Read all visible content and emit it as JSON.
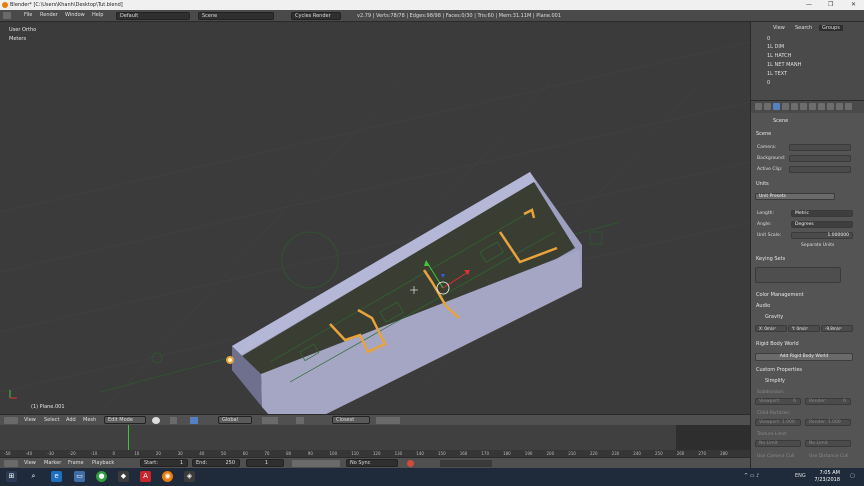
{
  "window": {
    "title": "Blender* [C:\\Users\\Khanh\\Desktop\\Tut.blend]",
    "controls": [
      "—",
      "❐",
      "✕"
    ]
  },
  "topbar": {
    "menus": [
      "File",
      "Render",
      "Window",
      "Help"
    ],
    "layout": "Default",
    "scene": "Scene",
    "engine": "Cycles Render",
    "stats": "v2.79 | Verts:78/78 | Edges:98/98 | Faces:0/30 | Tris:60 | Mem:31.11M | Plane.001"
  },
  "viewport": {
    "view_name": "User Ortho",
    "units": "Meters",
    "object_label": "(1) Plane.001"
  },
  "viewport_header": {
    "menus": [
      "View",
      "Select",
      "Add",
      "Mesh"
    ],
    "mode": "Edit Mode",
    "orientation": "Global",
    "snap": "Closest"
  },
  "timeline": {
    "ticks": [
      "-50",
      "-40",
      "-30",
      "-20",
      "-10",
      "0",
      "10",
      "20",
      "30",
      "40",
      "50",
      "60",
      "70",
      "80",
      "90",
      "100",
      "110",
      "120",
      "130",
      "140",
      "150",
      "160",
      "170",
      "180",
      "190",
      "200",
      "210",
      "220",
      "230",
      "240",
      "250",
      "260",
      "270",
      "280"
    ],
    "menus": [
      "View",
      "Marker",
      "Frame",
      "Playback"
    ],
    "start_label": "Start:",
    "start_value": "1",
    "end_label": "End:",
    "end_value": "250",
    "current_frame": "1",
    "sync": "No Sync"
  },
  "outliner": {
    "tabs": [
      "View",
      "Search",
      "Groups"
    ],
    "rows": [
      "0",
      "1L DIM",
      "1L HATCH",
      "1L NET MANH",
      "1L TEXT",
      "0"
    ]
  },
  "properties": {
    "scene_name": "Scene",
    "scene_section": "Scene",
    "camera_label": "Camera:",
    "background_label": "Background:",
    "active_clip_label": "Active Clip:",
    "units_section": "Units",
    "unit_presets": "Unit Presets",
    "length_label": "Length:",
    "length_value": "Metric",
    "angle_label": "Angle:",
    "angle_value": "Degrees",
    "unit_scale_label": "Unit Scale:",
    "unit_scale_value": "1.000000",
    "separate_units": "Separate Units",
    "keying_sets": "Keying Sets",
    "color_management": "Color Management",
    "audio": "Audio",
    "gravity": "Gravity",
    "gravity_x": "X: 0m/s²",
    "gravity_y": "Y: 0m/s²",
    "gravity_z": "-9.8m/s²",
    "rigid_body_world": "Rigid Body World",
    "add_rigid_body": "Add Rigid Body World",
    "custom_properties": "Custom Properties",
    "simplify": "Simplify",
    "subdivision": "Subdivision:",
    "viewport_label": "Viewport:",
    "viewport_value": "6",
    "render_label": "Render:",
    "render_value": "6",
    "child_particles": "Child Particles:",
    "child_viewport": "Viewport: 1.000",
    "child_render": "Render: 1.000",
    "texture_limit": "Texture Limit:",
    "no_limit_1": "No Limit",
    "no_limit_2": "No Limit",
    "use_camera_cull": "Use Camera Cull",
    "use_distance_cull": "Use Distance Cull"
  },
  "taskbar": {
    "time": "7:05 AM",
    "date": "7/23/2018",
    "lang": "ENG"
  },
  "colors": {
    "accent": "#5680c2",
    "wall_light": "#9d9fc0",
    "wall_top": "#b5b7d6",
    "wall_shadow": "#6e708d",
    "trim": "#e8a33a",
    "cad_green": "#2e6b2e",
    "timeline_cursor": "#3ec53e"
  }
}
